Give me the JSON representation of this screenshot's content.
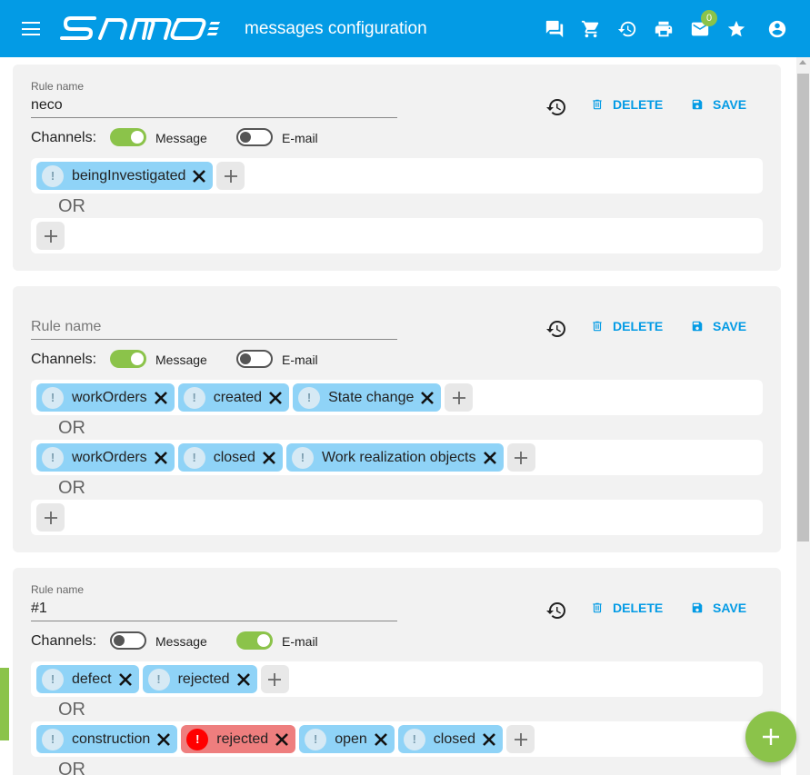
{
  "app": {
    "title": "messages configuration",
    "mail_badge": "0",
    "accent": "#039be5",
    "green": "#8bc34a"
  },
  "header_icons": [
    "menu-icon",
    "chat-icon",
    "cart-icon",
    "history-icon",
    "print-icon",
    "mail-icon",
    "star-icon",
    "account-icon"
  ],
  "labels": {
    "rule_name": "Rule name",
    "delete": "DELETE",
    "save": "SAVE",
    "channels": "Channels:",
    "message": "Message",
    "email": "E-mail",
    "or": "OR"
  },
  "rules": [
    {
      "name": "neco",
      "placeholder": "",
      "message_on": true,
      "email_on": false,
      "groups": [
        {
          "chips": [
            {
              "text": "beingInvestigated",
              "state": "normal"
            }
          ]
        },
        {
          "chips": []
        }
      ]
    },
    {
      "name": "",
      "placeholder": "Rule name",
      "message_on": true,
      "email_on": false,
      "groups": [
        {
          "chips": [
            {
              "text": "workOrders",
              "state": "normal"
            },
            {
              "text": "created",
              "state": "normal"
            },
            {
              "text": "State change",
              "state": "normal"
            }
          ]
        },
        {
          "chips": [
            {
              "text": "workOrders",
              "state": "normal"
            },
            {
              "text": "closed",
              "state": "normal"
            },
            {
              "text": "Work realization objects",
              "state": "normal"
            }
          ]
        },
        {
          "chips": []
        }
      ]
    },
    {
      "name": "#1",
      "placeholder": "",
      "message_on": false,
      "email_on": true,
      "groups": [
        {
          "chips": [
            {
              "text": "defect",
              "state": "normal"
            },
            {
              "text": "rejected",
              "state": "normal"
            }
          ]
        },
        {
          "chips": [
            {
              "text": "construction",
              "state": "normal"
            },
            {
              "text": "rejected",
              "state": "error"
            },
            {
              "text": "open",
              "state": "normal"
            },
            {
              "text": "closed",
              "state": "normal"
            }
          ]
        }
      ]
    }
  ]
}
